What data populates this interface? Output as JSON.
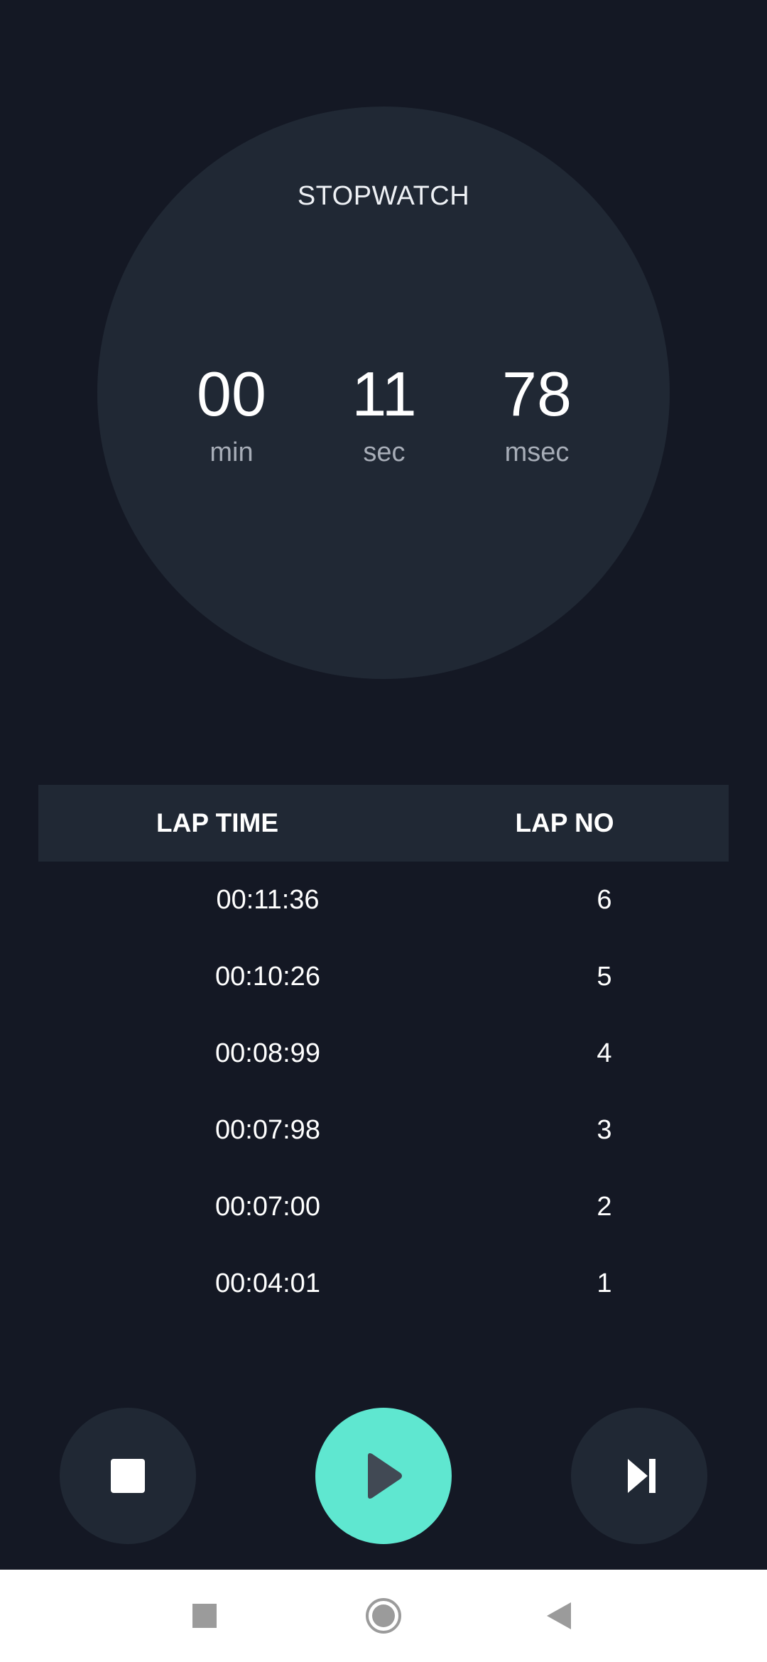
{
  "stopwatch": {
    "title": "STOPWATCH",
    "minutes": "00",
    "minutes_label": "min",
    "seconds": "11",
    "seconds_label": "sec",
    "milliseconds": "78",
    "milliseconds_label": "msec"
  },
  "laps": {
    "headers": {
      "lap_time": "LAP TIME",
      "lap_no": "LAP NO"
    },
    "rows": [
      {
        "time": "00:11:36",
        "no": "6"
      },
      {
        "time": "00:10:26",
        "no": "5"
      },
      {
        "time": "00:08:99",
        "no": "4"
      },
      {
        "time": "00:07:98",
        "no": "3"
      },
      {
        "time": "00:07:00",
        "no": "2"
      },
      {
        "time": "00:04:01",
        "no": "1"
      }
    ]
  },
  "controls": {
    "stop_icon": "stop-icon",
    "play_icon": "play-icon",
    "lap_icon": "skip-next-icon"
  },
  "navigation": {
    "recents_icon": "square-icon",
    "home_icon": "circle-icon",
    "back_icon": "triangle-back-icon"
  },
  "colors": {
    "background": "#141824",
    "surface": "#202834",
    "accent": "#5fe7d0",
    "label": "#a7adb7"
  }
}
